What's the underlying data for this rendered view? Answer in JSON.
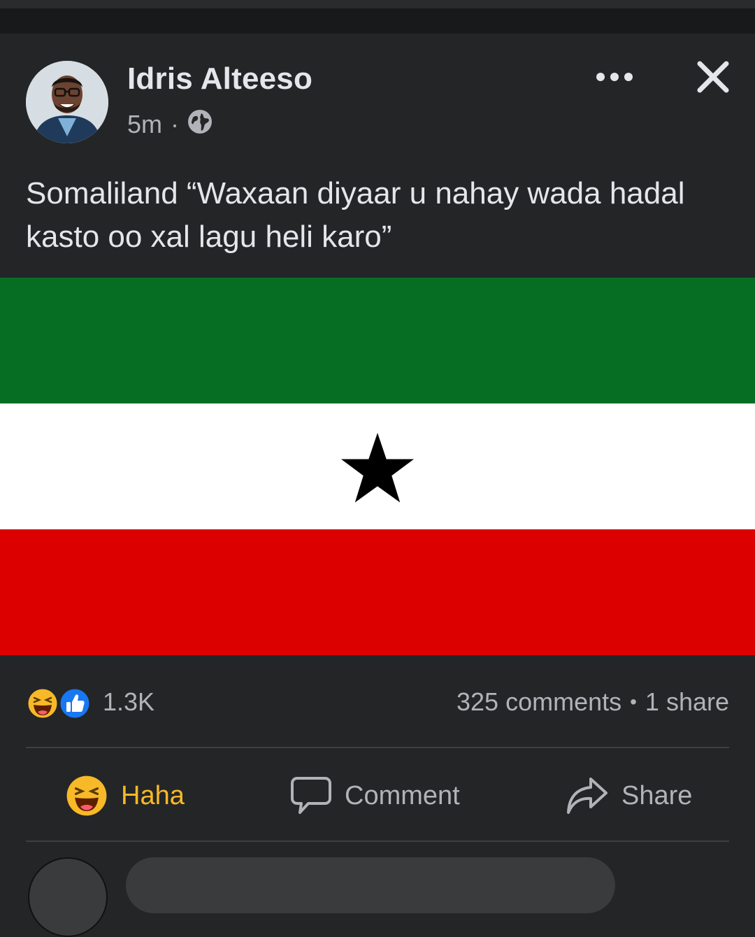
{
  "post": {
    "author": "Idris Alteeso",
    "time": "5m",
    "separator": "·",
    "text": "Somaliland “Waxaan diyaar u nahay wada hadal kasto oo xal lagu heli karo”",
    "privacy_icon": "globe-icon"
  },
  "image": {
    "description_colors": {
      "green": "#066e23",
      "white": "#ffffff",
      "red": "#dc0000",
      "star": "#000000"
    }
  },
  "engagement": {
    "reaction_icons": [
      "haha-reaction-icon",
      "like-reaction-icon"
    ],
    "reaction_count": "1.3K",
    "comments": "325 comments",
    "bullet": "•",
    "shares": "1 share"
  },
  "actions": {
    "haha_label": "Haha",
    "comment_label": "Comment",
    "share_label": "Share"
  },
  "colors": {
    "background": "#242526",
    "text_primary": "#e4e6eb",
    "text_secondary": "#b0b3b8",
    "haha_accent": "#f7b928",
    "like_blue": "#1877f2"
  }
}
